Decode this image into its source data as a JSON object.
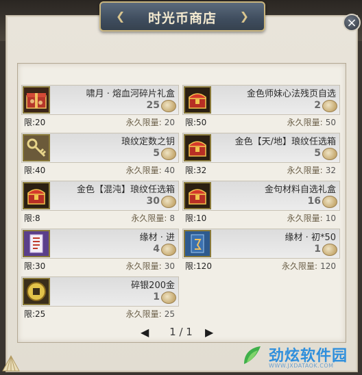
{
  "shop": {
    "title": "时光币商店",
    "close_label": "×",
    "pagination": {
      "current": "1",
      "separator": "/",
      "total": "1",
      "text": "1 / 1"
    }
  },
  "items": [
    {
      "name": "啸月 · 熔血河碎片礼盒",
      "price": "25",
      "limit": "限:20",
      "perm_label": "永久限量:",
      "perm_value": "20",
      "icon": "red-gift-box-icon"
    },
    {
      "name": "金色师妹心法残页自选",
      "price": "2",
      "limit": "限:50",
      "perm_label": "永久限量:",
      "perm_value": "50",
      "icon": "red-treasure-chest-icon"
    },
    {
      "name": "琅纹定数之钥",
      "price": "5",
      "limit": "限:40",
      "perm_label": "永久限量:",
      "perm_value": "40",
      "icon": "golden-key-icon"
    },
    {
      "name": "金色【天/地】琅纹任选箱",
      "price": "5",
      "limit": "限:32",
      "perm_label": "永久限量:",
      "perm_value": "32",
      "icon": "red-treasure-chest-icon"
    },
    {
      "name": "金色【混沌】琅纹任选箱",
      "price": "30",
      "limit": "限:8",
      "perm_label": "永久限量:",
      "perm_value": "8",
      "icon": "red-treasure-chest-icon"
    },
    {
      "name": "金句材料自选礼盒",
      "price": "16",
      "limit": "限:10",
      "perm_label": "永久限量:",
      "perm_value": "10",
      "icon": "red-treasure-chest-icon"
    },
    {
      "name": "缘材 · 进",
      "price": "4",
      "limit": "限:30",
      "perm_label": "永久限量:",
      "perm_value": "30",
      "icon": "purple-scroll-card-icon"
    },
    {
      "name": "缘材 · 初*50",
      "price": "1",
      "limit": "限:120",
      "perm_label": "永久限量:",
      "perm_value": "120",
      "icon": "blue-scroll-card-icon"
    },
    {
      "name": "碎银200金",
      "price": "1",
      "limit": "限:25",
      "perm_label": "永久限量:",
      "perm_value": "25",
      "icon": "gold-coin-icon"
    }
  ],
  "watermark": {
    "text": "劲炫软件园",
    "url": "WWW.JXDATAOK.COM"
  }
}
